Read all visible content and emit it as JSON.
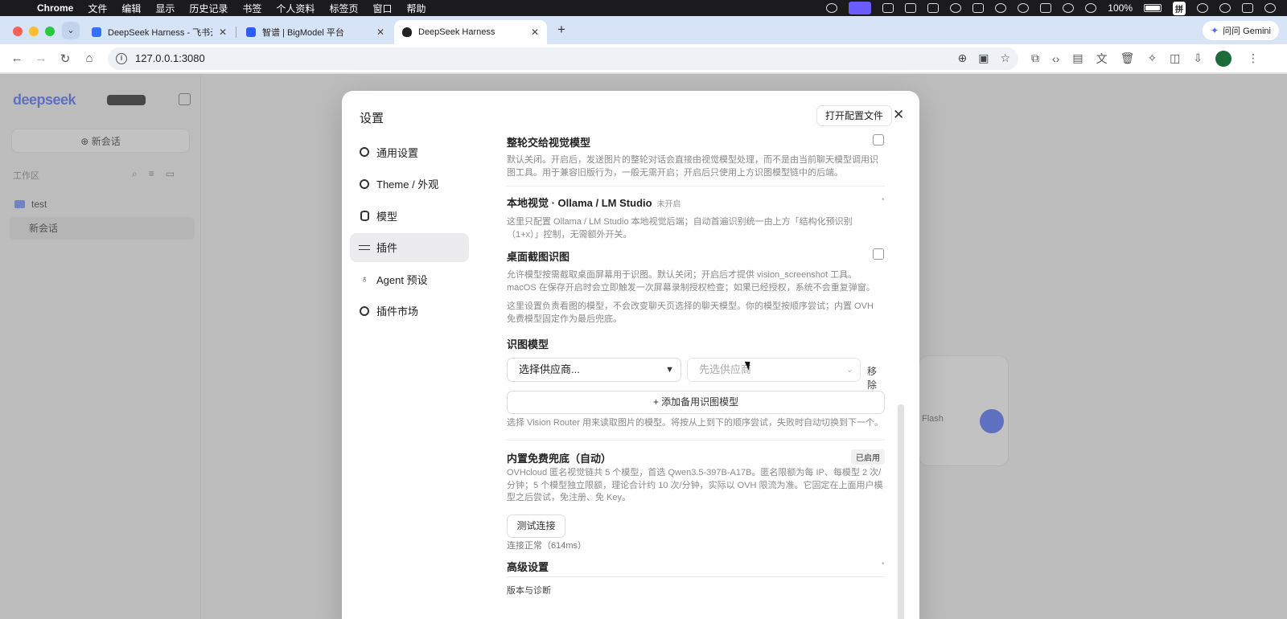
{
  "menubar": {
    "app": "Chrome",
    "items": [
      "文件",
      "编辑",
      "显示",
      "历史记录",
      "书签",
      "个人资料",
      "标签页",
      "窗口",
      "帮助"
    ],
    "battery": "100%",
    "ime": "拼"
  },
  "browser": {
    "tabs": [
      {
        "title": "DeepSeek Harness - 飞书云文档",
        "favicon_color": "#3370ff",
        "active": false
      },
      {
        "title": "智谱 | BigModel 平台",
        "favicon_color": "#2b5dff",
        "active": false
      },
      {
        "title": "DeepSeek Harness",
        "favicon_color": "#222222",
        "active": true
      }
    ],
    "ask_button": "问问 Gemini",
    "url": "127.0.0.1:3080"
  },
  "app_bg": {
    "logo": "deepseek",
    "new_chat": "新会话",
    "workspace_label": "工作区",
    "folder": "test",
    "session": "新会话",
    "composer_model": "Flash"
  },
  "settings": {
    "title": "设置",
    "open_config": "打开配置文件",
    "nav": [
      {
        "label": "通用设置",
        "icon": "gear-icon",
        "active": false
      },
      {
        "label": "Theme / 外观",
        "icon": "gear-icon",
        "active": false
      },
      {
        "label": "模型",
        "icon": "database-icon",
        "active": false
      },
      {
        "label": "插件",
        "icon": "sliders-icon",
        "active": true
      },
      {
        "label": "Agent 预设",
        "icon": "lightbulb-icon",
        "active": false
      },
      {
        "label": "插件市场",
        "icon": "gear-icon",
        "active": false
      }
    ],
    "whole_round": {
      "title": "整轮交给视觉模型",
      "desc": "默认关闭。开启后，发送图片的整轮对话会直接由视觉模型处理，而不是由当前聊天模型调用识图工具。用于兼容旧版行为，一般无需开启；开启后只使用上方识图模型链中的后端。",
      "checked": false
    },
    "local_vision": {
      "title": "本地视觉 · Ollama / LM Studio",
      "status": "未开启",
      "desc": "这里只配置 Ollama / LM Studio 本地视觉后端；自动首遍识别统一由上方「结构化预识别（1+x）」控制，无需额外开关。"
    },
    "desktop_screenshot": {
      "title": "桌面截图识图",
      "desc": "允许模型按需截取桌面屏幕用于识图。默认关闭；开启后才提供 vision_screenshot 工具。macOS 在保存开启时会立即触发一次屏幕录制授权检查；如果已经授权，系统不会重复弹窗。",
      "checked": false
    },
    "vision_note": "这里设置负责看图的模型，不会改变聊天页选择的聊天模型。你的模型按顺序尝试；内置 OVH 免费模型固定作为最后兜底。",
    "vision_model": {
      "label": "识图模型",
      "provider_placeholder": "选择供应商...",
      "model_placeholder": "先选供应商",
      "remove": "移除",
      "add_backup": "+ 添加备用识图模型",
      "help": "选择 Vision Router 用来读取图片的模型。将按从上到下的顺序尝试，失败时自动切换到下一个。"
    },
    "builtin_fallback": {
      "title": "内置免费兜底（自动）",
      "badge": "已启用",
      "desc": "OVHcloud 匿名视觉链共 5 个模型，首选 Qwen3.5-397B-A17B。匿名限额为每 IP、每模型 2 次/分钟；5 个模型独立限额，理论合计约 10 次/分钟，实际以 OVH 限流为准。它固定在上面用户模型之后尝试，免注册、免 Key。",
      "test_button": "测试连接",
      "test_status": "连接正常（614ms）"
    },
    "advanced": {
      "title": "高级设置"
    },
    "version": {
      "title": "版本与诊断"
    }
  }
}
